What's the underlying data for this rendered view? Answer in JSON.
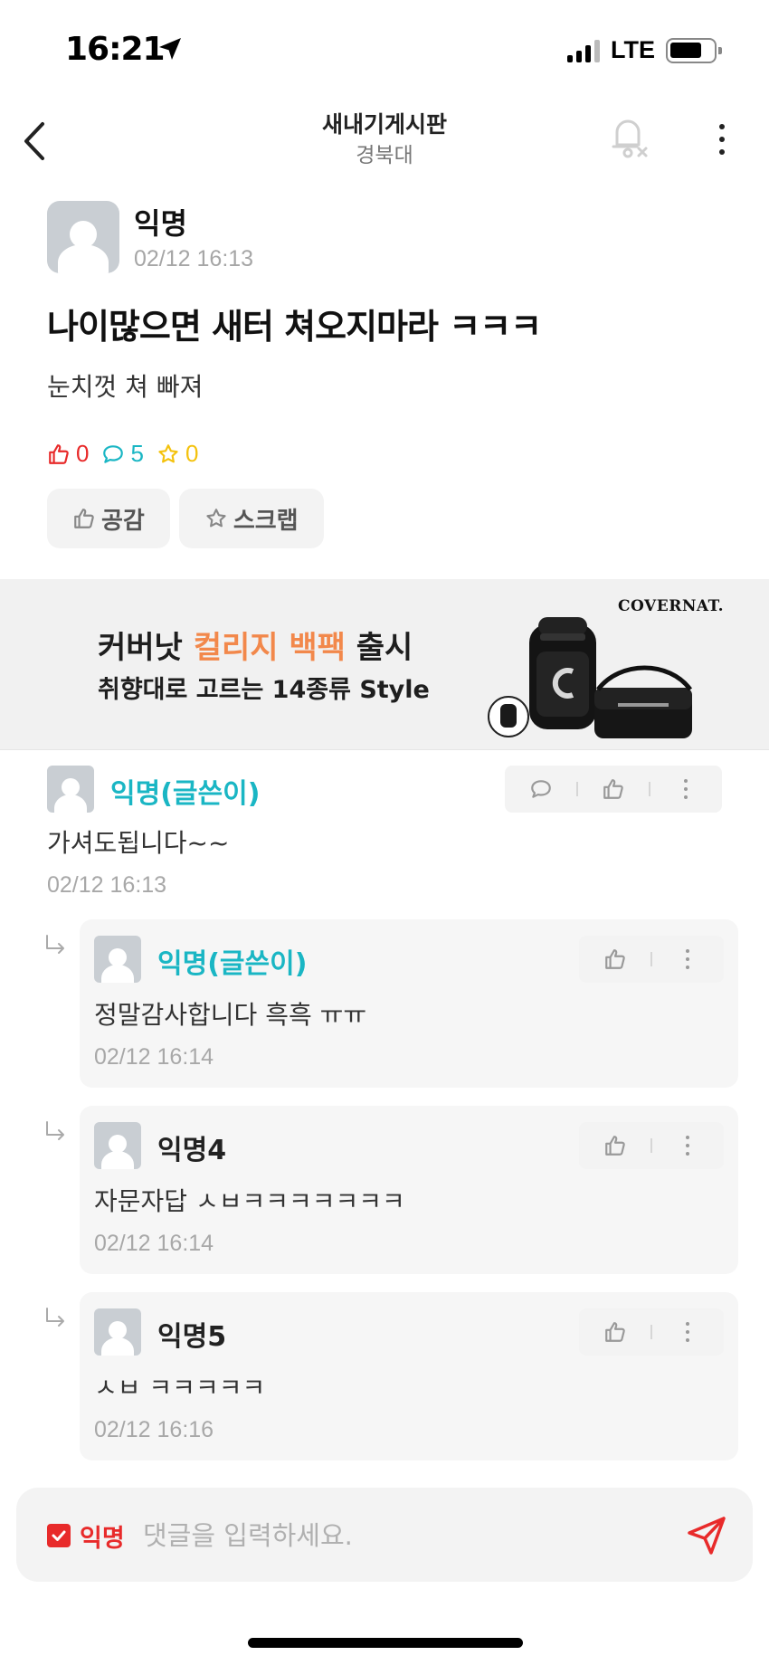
{
  "status_bar": {
    "time": "16:21",
    "network": "LTE"
  },
  "header": {
    "title": "새내기게시판",
    "subtitle": "경북대"
  },
  "post": {
    "author": "익명",
    "time": "02/12 16:13",
    "title": "나이많으면 새터 쳐오지마라 ㅋㅋㅋ",
    "body": "눈치껏 쳐 빠져",
    "stats": {
      "likes": "0",
      "comments": "5",
      "scraps": "0"
    },
    "actions": {
      "like_label": "공감",
      "scrap_label": "스크랩"
    }
  },
  "ad": {
    "line1_prefix": "커버낫 ",
    "line1_accent": "컬리지 백팩",
    "line1_suffix": " 출시",
    "line2": "취향대로 고르는 14종류 Style",
    "brand": "COVERNAT."
  },
  "comments": [
    {
      "author": "익명(글쓴이)",
      "text": "가셔도됩니다~~",
      "time": "02/12 16:13",
      "replies": [
        {
          "author": "익명(글쓴이)",
          "text": "정말감사합니다 흑흑 ㅠㅠ",
          "time": "02/12 16:14"
        },
        {
          "author": "익명4",
          "text": "자문자답 ㅅㅂㅋㅋㅋㅋㅋㅋㅋ",
          "time": "02/12 16:14"
        },
        {
          "author": "익명5",
          "text": "ㅅㅂ ㅋㅋㅋㅋㅋ",
          "time": "02/12 16:16"
        }
      ]
    }
  ],
  "comment_input": {
    "anon_label": "익명",
    "placeholder": "댓글을 입력하세요."
  },
  "colors": {
    "like": "#e82a2a",
    "comment": "#1ab6c4",
    "scrap": "#f4c20d",
    "op_name": "#1ab6c4",
    "ad_accent": "#f2884b"
  },
  "icons": [
    "location-arrow-icon",
    "signal-icon",
    "battery-icon",
    "back-icon",
    "bell-off-icon",
    "more-icon",
    "thumbs-up-icon",
    "comment-icon",
    "star-icon",
    "reply-arrow-icon",
    "send-icon",
    "checkbox-icon"
  ]
}
